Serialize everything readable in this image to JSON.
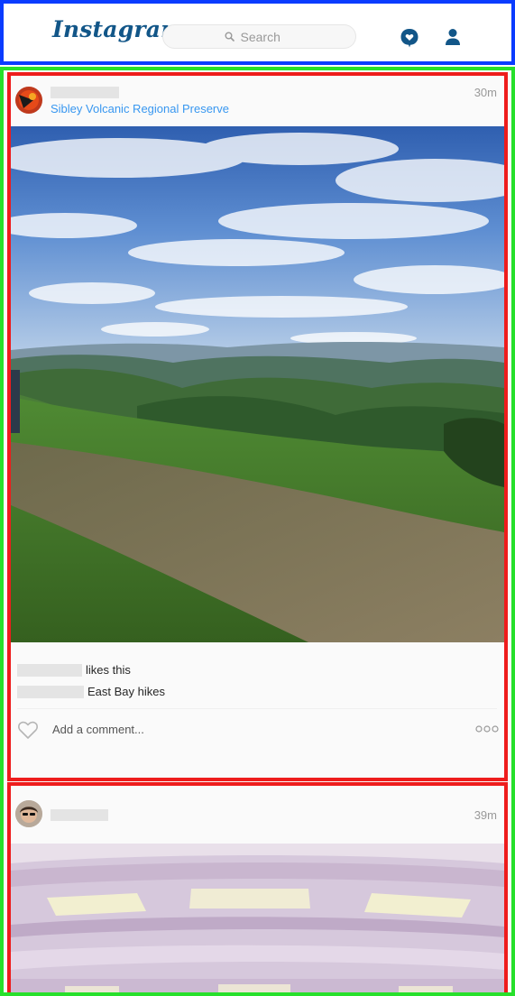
{
  "header": {
    "logo": "Instagram",
    "search_placeholder": "Search",
    "icons": [
      "activity-icon",
      "profile-icon"
    ]
  },
  "posts": [
    {
      "location": "Sibley Volcanic Regional Preserve",
      "time": "30m",
      "likes_text": "likes this",
      "caption": "East Bay hikes",
      "comment_placeholder": "Add a comment..."
    },
    {
      "time": "39m"
    }
  ],
  "colors": {
    "link": "#3897f0",
    "logo": "#125688",
    "header_border": "#0a3cff",
    "feed_border": "#27e02b",
    "post_border": "#ee1c1c"
  }
}
